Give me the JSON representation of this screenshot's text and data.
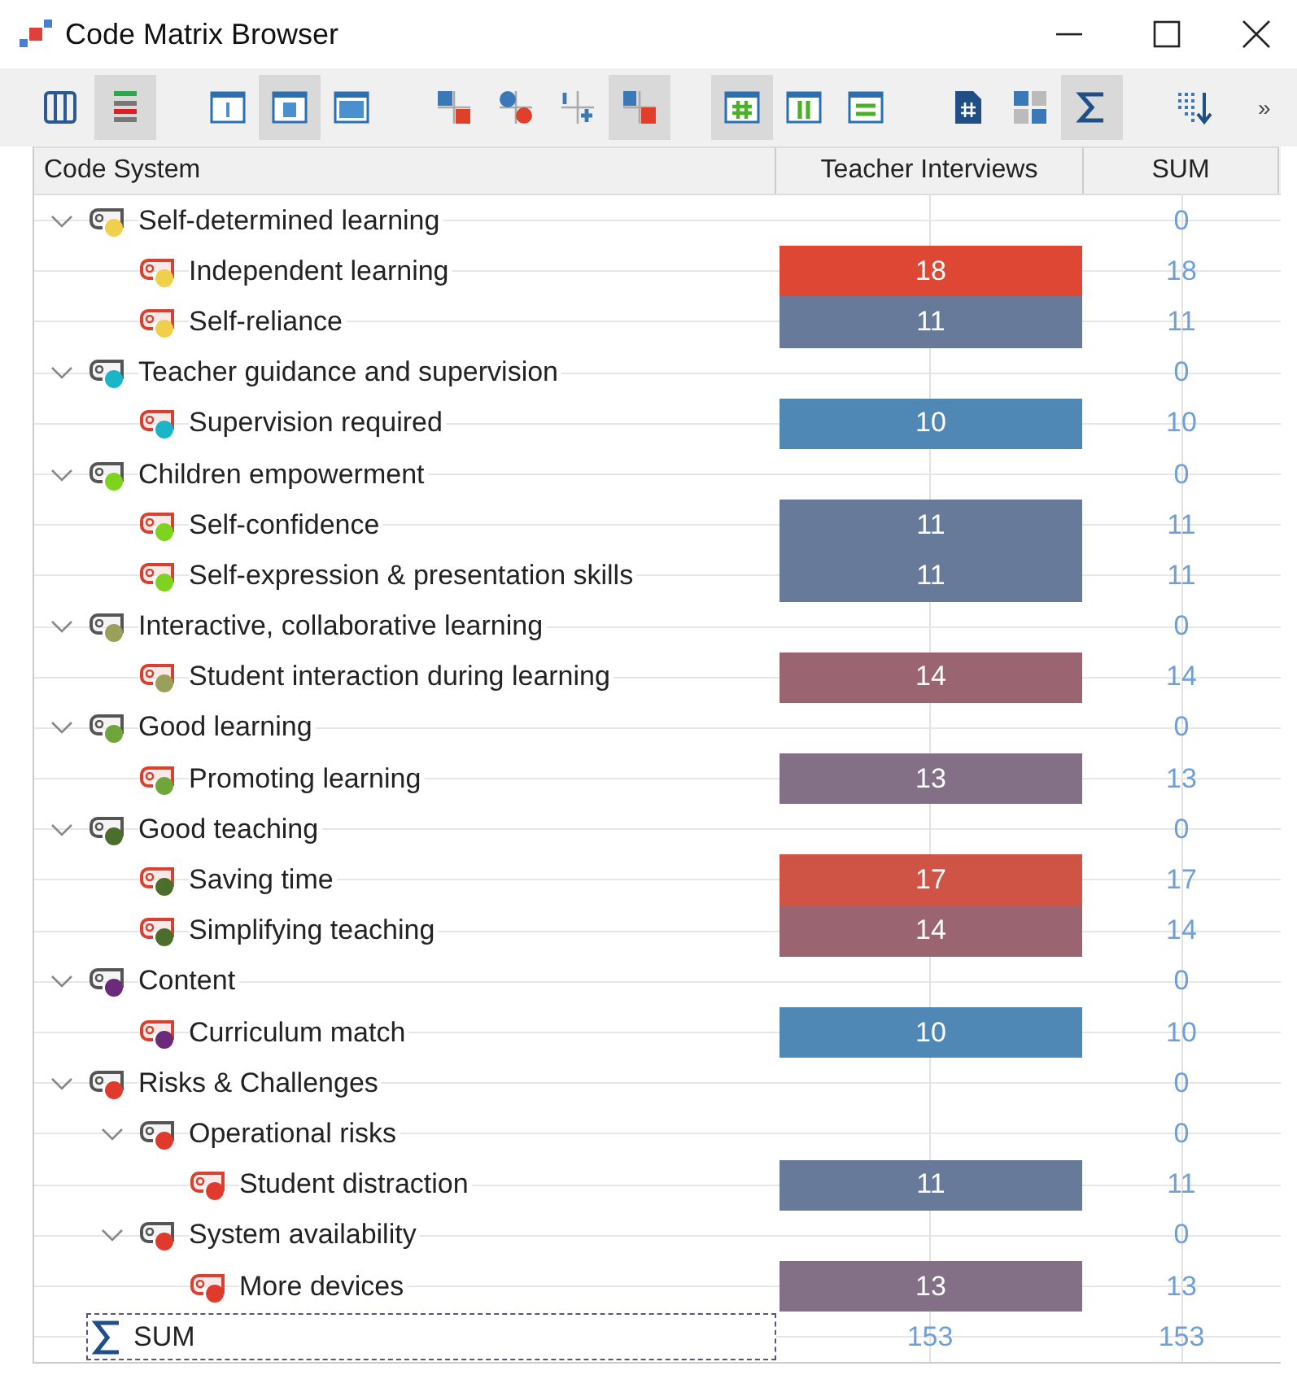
{
  "window": {
    "title": "Code Matrix Browser"
  },
  "toolbar": [
    {
      "kind": "columns",
      "selected": false
    },
    {
      "kind": "color-rows",
      "selected": true
    },
    {
      "kind": "panel-narrow",
      "selected": false
    },
    {
      "kind": "panel-medium",
      "selected": true
    },
    {
      "kind": "panel-wide",
      "selected": false
    },
    {
      "kind": "square-link",
      "selected": false
    },
    {
      "kind": "circle-link",
      "selected": false
    },
    {
      "kind": "cross-link",
      "selected": false
    },
    {
      "kind": "boxed-link",
      "selected": true
    },
    {
      "kind": "hash-grid",
      "selected": true
    },
    {
      "kind": "column-grid",
      "selected": false
    },
    {
      "kind": "row-grid",
      "selected": false
    },
    {
      "kind": "hash-doc",
      "selected": false
    },
    {
      "kind": "quads",
      "selected": false
    },
    {
      "kind": "sigma",
      "selected": true
    },
    {
      "kind": "sort",
      "selected": false
    }
  ],
  "toolbar_overflow": "»",
  "table": {
    "columns": [
      "Code System",
      "Teacher Interviews",
      "SUM"
    ],
    "codes": [
      {
        "name": "Self-determined learning",
        "color": "#f0cf4a",
        "expanded": true,
        "sum": "0",
        "children": [
          {
            "name": "Independent learning",
            "color": "#f0cf4a",
            "cell": {
              "value": "18",
              "color": "#dd4733"
            },
            "sum": "18"
          },
          {
            "name": "Self-reliance",
            "color": "#f0cf4a",
            "cell": {
              "value": "11",
              "color": "#677a99"
            },
            "sum": "11"
          }
        ]
      },
      {
        "name": "Teacher guidance and supervision",
        "color": "#1ab5c9",
        "expanded": true,
        "sum": "0",
        "children": [
          {
            "name": "Supervision required",
            "color": "#1ab5c9",
            "cell": {
              "value": "10",
              "color": "#4f87b5"
            },
            "sum": "10"
          }
        ]
      },
      {
        "name": "Children empowerment",
        "color": "#7ed321",
        "expanded": true,
        "sum": "0",
        "children": [
          {
            "name": "Self-confidence",
            "color": "#7ed321",
            "cell": {
              "value": "11",
              "color": "#677a99"
            },
            "sum": "11"
          },
          {
            "name": "Self-expression & presentation skills",
            "color": "#7ed321",
            "cell": {
              "value": "11",
              "color": "#677a99"
            },
            "sum": "11"
          }
        ]
      },
      {
        "name": "Interactive, collaborative learning",
        "color": "#9aa05a",
        "expanded": true,
        "sum": "0",
        "children": [
          {
            "name": "Student interaction during learning",
            "color": "#9aa05a",
            "cell": {
              "value": "14",
              "color": "#9a6470"
            },
            "sum": "14"
          }
        ]
      },
      {
        "name": "Good learning",
        "color": "#6fa53a",
        "expanded": true,
        "sum": "0",
        "children": [
          {
            "name": "Promoting learning",
            "color": "#6fa53a",
            "cell": {
              "value": "13",
              "color": "#836f86"
            },
            "sum": "13"
          }
        ]
      },
      {
        "name": "Good teaching",
        "color": "#4b6e2a",
        "expanded": true,
        "sum": "0",
        "children": [
          {
            "name": "Saving time",
            "color": "#4b6e2a",
            "cell": {
              "value": "17",
              "color": "#cf5446"
            },
            "sum": "17"
          },
          {
            "name": "Simplifying teaching",
            "color": "#4b6e2a",
            "cell": {
              "value": "14",
              "color": "#9a6470"
            },
            "sum": "14"
          }
        ]
      },
      {
        "name": "Content",
        "color": "#6b2a7a",
        "expanded": true,
        "sum": "0",
        "children": [
          {
            "name": "Curriculum match",
            "color": "#6b2a7a",
            "cell": {
              "value": "10",
              "color": "#4f87b5"
            },
            "sum": "10"
          }
        ]
      },
      {
        "name": "Risks & Challenges",
        "color": "#e03a2c",
        "expanded": true,
        "sum": "0",
        "children": [
          {
            "name": "Operational risks",
            "color": "#e03a2c",
            "expanded": true,
            "sum": "0",
            "children": [
              {
                "name": "Student distraction",
                "color": "#e03a2c",
                "cell": {
                  "value": "11",
                  "color": "#677a99"
                },
                "sum": "11"
              }
            ]
          },
          {
            "name": "System availability",
            "color": "#e03a2c",
            "expanded": true,
            "sum": "0",
            "children": [
              {
                "name": "More devices",
                "color": "#e03a2c",
                "cell": {
                  "value": "13",
                  "color": "#836f86"
                },
                "sum": "13"
              }
            ]
          }
        ]
      }
    ],
    "total": {
      "label": "SUM",
      "value": "153",
      "sum": "153"
    }
  }
}
